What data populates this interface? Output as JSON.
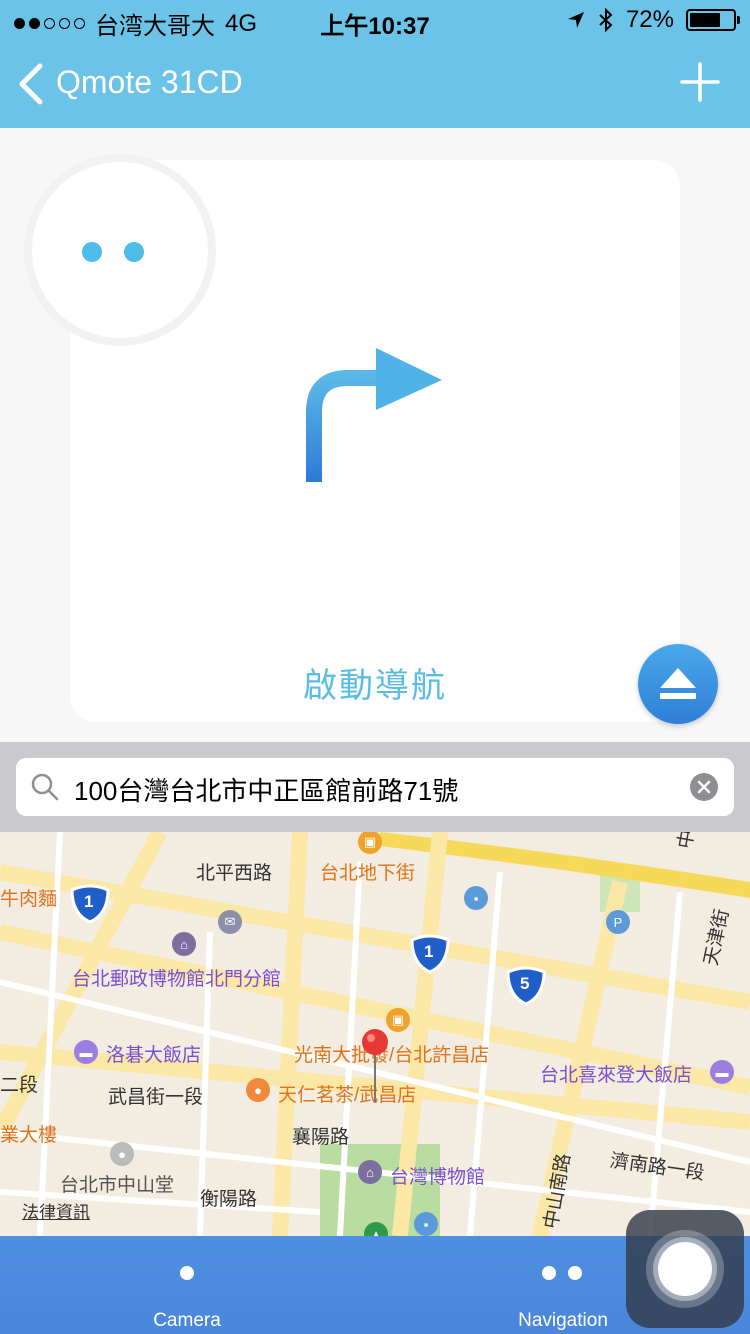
{
  "status_bar": {
    "carrier": "台湾大哥大",
    "network": "4G",
    "time": "上午10:37",
    "battery_percent_label": "72%",
    "battery_level": 0.72
  },
  "nav": {
    "title": "Qmote 31CD"
  },
  "main": {
    "start_navigation_label": "啟動導航"
  },
  "search": {
    "value": "100台灣台北市中正區館前路71號"
  },
  "map": {
    "labels": {
      "beiping_west_rd": "北平西路",
      "taipei_underground_mall": "台北地下街",
      "beef_noodles_partial": "牛肉麵",
      "postal_museum": "台北郵政博物館北門分館",
      "tianjin_st": "天津街",
      "cosmos_hotel": "洛碁大飯店",
      "guangnan": "光南大批發/台北許昌店",
      "sheraton": "台北喜來登大飯店",
      "erduan_partial": "二段",
      "wuchang_st": "武昌街一段",
      "tenren_tea": "天仁茗茶/武昌店",
      "building_partial": "業大樓",
      "xiangyang_rd": "襄陽路",
      "zhongshan_hall": "台北市中山堂",
      "national_taiwan_museum": "台灣博物館",
      "jinan_rd": "濟南路一段",
      "zhongshan_s_rd": "中山南路",
      "hengyang_rd": "衡陽路",
      "legal_info": "法律資訊",
      "zhongshan_partial": "中山"
    },
    "shields": {
      "route_1a": "1",
      "route_1b": "1",
      "route_5": "5"
    }
  },
  "tabs": {
    "camera": "Camera",
    "navigation": "Navigation"
  },
  "colors": {
    "accent": "#6bc4e8",
    "tab_bar": "#4a86db",
    "text_link": "#5bbde4"
  }
}
